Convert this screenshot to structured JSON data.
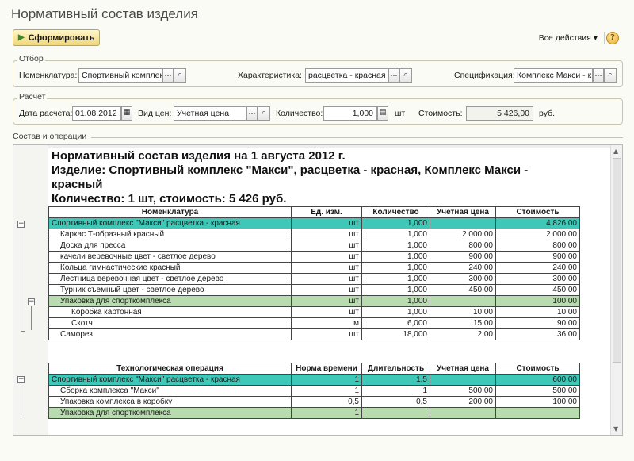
{
  "window": {
    "title": "Нормативный состав изделия"
  },
  "toolbar": {
    "form_button": "Сформировать",
    "all_actions": "Все действия ▾",
    "help": "?"
  },
  "filter": {
    "title": "Отбор",
    "nomenclature_label": "Номенклатура:",
    "nomenclature_value": "Спортивный комплек",
    "characteristic_label": "Характеристика:",
    "characteristic_value": "расцветка - красная",
    "spec_label": "Спецификация:",
    "spec_value": "Комплекс Макси - к"
  },
  "calc": {
    "title": "Расчет",
    "date_label": "Дата расчета:",
    "date_value": "01.08.2012",
    "price_label": "Вид цен:",
    "price_value": "Учетная цена",
    "qty_label": "Количество:",
    "qty_value": "1,000",
    "qty_unit": "шт",
    "cost_label": "Стоимость:",
    "cost_value": "5 426,00",
    "cost_unit": "руб."
  },
  "section": {
    "title": "Состав и операции"
  },
  "report": {
    "line1": "Нормативный состав изделия на 1 августа 2012 г.",
    "line2": "Изделие: Спортивный комплекс \"Макси\", расцветка - красная, Комплекс Макси -",
    "line3": "красный",
    "line4": "Количество: 1 шт, стоимость: 5 426 руб.",
    "comp_headers": [
      "Номенклатура",
      "Ед. изм.",
      "Количество",
      "Учетная цена",
      "Стоимость"
    ],
    "comp_rows": [
      [
        "Спортивный комплекс \"Макси\" расцветка - красная",
        "шт",
        "1,000",
        "",
        "4 826,00"
      ],
      [
        "Каркас Т-образный красный",
        "шт",
        "1,000",
        "2 000,00",
        "2 000,00"
      ],
      [
        "Доска для пресса",
        "шт",
        "1,000",
        "800,00",
        "800,00"
      ],
      [
        "качели веревочные цвет - светлое дерево",
        "шт",
        "1,000",
        "900,00",
        "900,00"
      ],
      [
        "Кольца гимнастические красный",
        "шт",
        "1,000",
        "240,00",
        "240,00"
      ],
      [
        "Лестница веревочная цвет - светлое дерево",
        "шт",
        "1,000",
        "300,00",
        "300,00"
      ],
      [
        "Турник съемный цвет - светлое дерево",
        "шт",
        "1,000",
        "450,00",
        "450,00"
      ],
      [
        "Упаковка для спорткомплекса",
        "шт",
        "1,000",
        "",
        "100,00"
      ],
      [
        "Коробка картонная",
        "шт",
        "1,000",
        "10,00",
        "10,00"
      ],
      [
        "Скотч",
        "м",
        "6,000",
        "15,00",
        "90,00"
      ],
      [
        "Саморез",
        "шт",
        "18,000",
        "2,00",
        "36,00"
      ]
    ],
    "ops_headers": [
      "Технологическая операция",
      "Норма времени",
      "Длительность",
      "Учетная цена",
      "Стоимость"
    ],
    "ops_rows": [
      [
        "Спортивный комплекс \"Макси\" расцветка - красная",
        "1",
        "1,5",
        "",
        "600,00"
      ],
      [
        "Сборка комплекса \"Макси\"",
        "1",
        "1",
        "500,00",
        "500,00"
      ],
      [
        "Упаковка комплекса в коробку",
        "0,5",
        "0,5",
        "200,00",
        "100,00"
      ],
      [
        "Упаковка для спорткомплекса",
        "1",
        "",
        "",
        ""
      ]
    ]
  },
  "colors": {
    "group_row": "#3fc8b7",
    "subgroup_row": "#b9dbb0"
  }
}
